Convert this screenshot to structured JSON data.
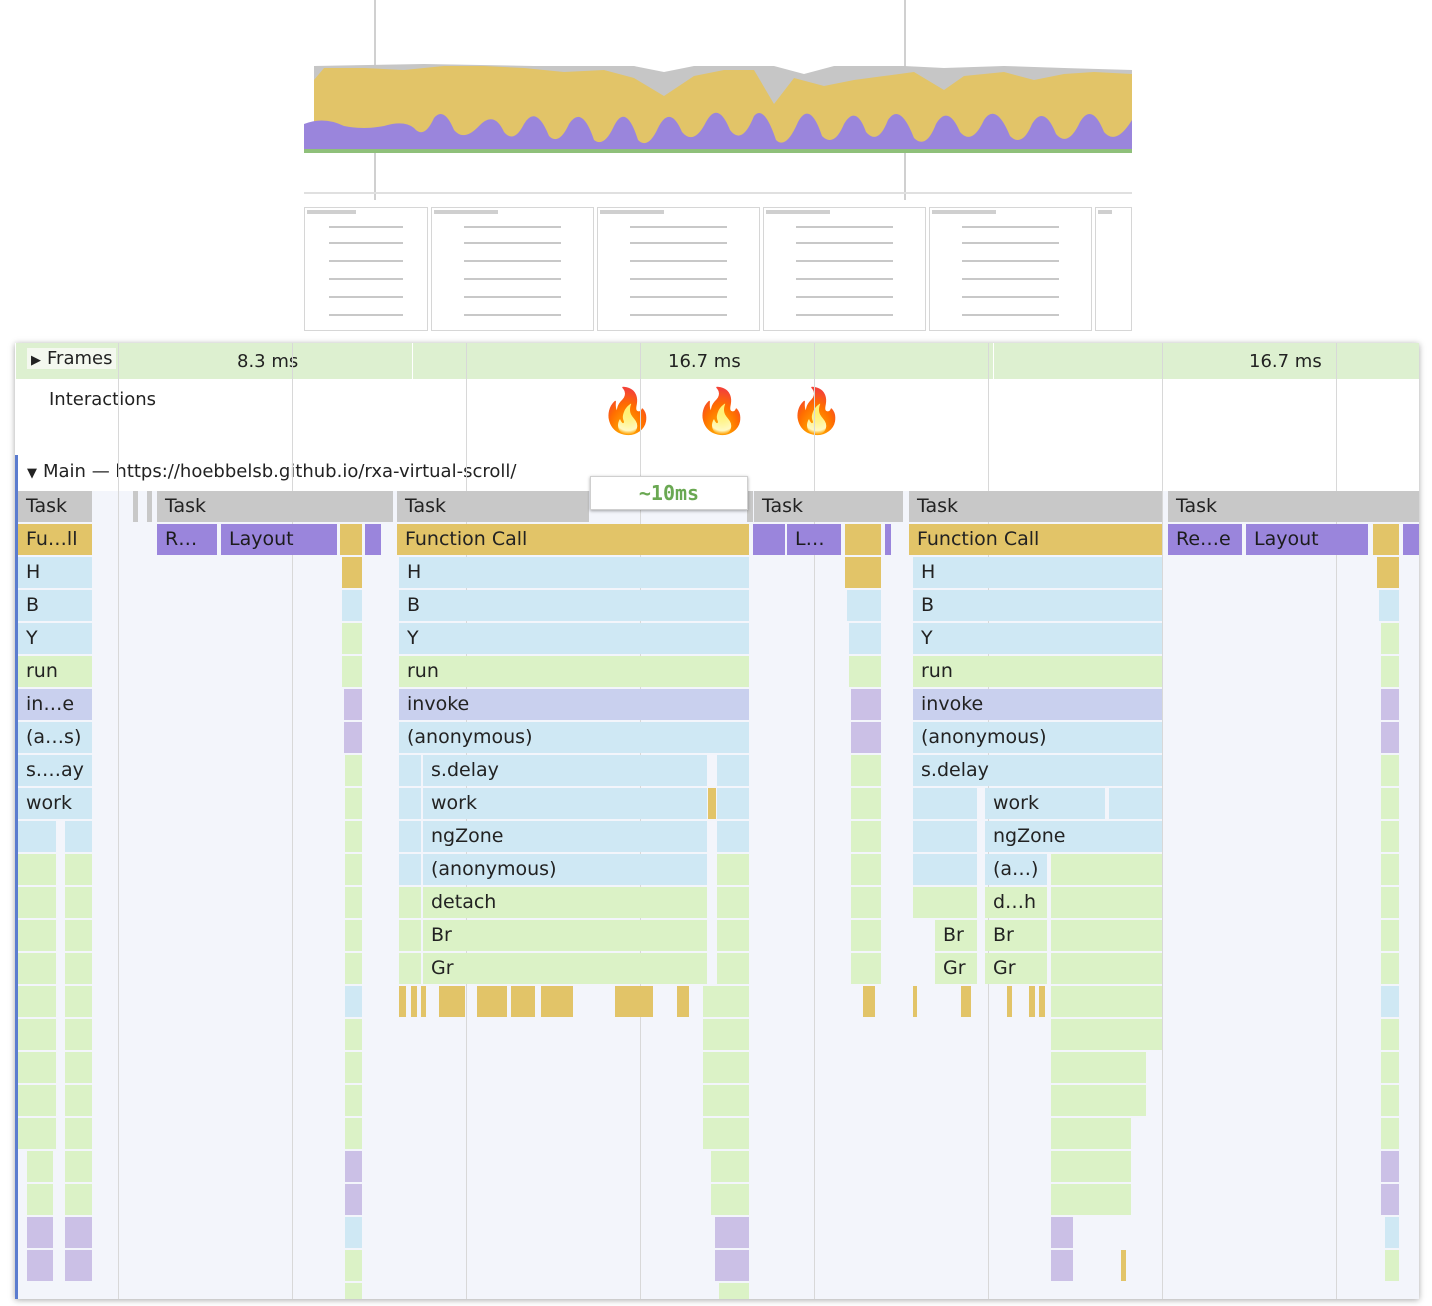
{
  "frames": {
    "title": "Frames",
    "labels": [
      "8.3 ms",
      "16.7 ms",
      "16.7 ms"
    ]
  },
  "interactions": {
    "title": "Interactions",
    "markers": [
      "🔥",
      "🔥",
      "🔥"
    ]
  },
  "main": {
    "title": "Main — https://hoebbelsb.github.io/rxa-virtual-scroll/"
  },
  "callout": {
    "text": "~10ms"
  },
  "flame": {
    "task_label": "Task",
    "group1": [
      "Fu…ll",
      "H",
      "B",
      "Y",
      "run",
      "in…e",
      "(a…s)",
      "s.…ay",
      "work"
    ],
    "group2": [
      "R…",
      "Layout"
    ],
    "group3": [
      "Function Call",
      "H",
      "B",
      "Y",
      "run",
      "invoke",
      "(anonymous)",
      "s.delay",
      "work",
      "ngZone",
      "(anonymous)",
      "detach",
      "Br",
      "Gr"
    ],
    "group4": [
      "L…"
    ],
    "group5": [
      "Function Call",
      "H",
      "B",
      "Y",
      "run",
      "invoke",
      "(anonymous)",
      "s.delay",
      "work",
      "ngZone",
      "(a…)",
      "d…h",
      "Br",
      "Br",
      "Gr",
      "Gr"
    ],
    "group6": [
      "Re…e",
      "Layout"
    ]
  },
  "colors": {
    "task": "#c8c8c8",
    "scripting": "#e2c468",
    "rendering": "#9a85dc",
    "blue_frame": "#cfe8f4",
    "green_frame": "#dbf2c6",
    "lavender_frame": "#c9d0ee",
    "callout_text": "#6aa852"
  }
}
